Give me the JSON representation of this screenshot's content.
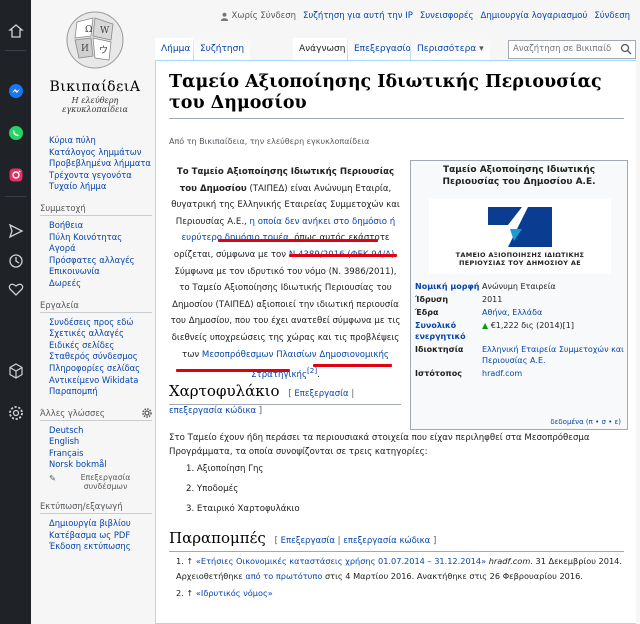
{
  "browser": {
    "rail_icons": [
      "home-icon",
      "messenger-icon",
      "whatsapp-icon",
      "instagram-icon",
      "send-icon",
      "history-icon",
      "heart-icon",
      "cube-icon",
      "settings-icon"
    ]
  },
  "logo": {
    "wordmark": "ΒικιπαίδειΑ",
    "tagline": "Η ελεύθερη εγκυκλοπαίδεια"
  },
  "personal": {
    "anon": "Χωρίς Σύνδεση",
    "talk": "Συζήτηση για αυτή την IP",
    "contribs": "Συνεισφορές",
    "create": "Δημιουργία λογαριασμού",
    "login": "Σύνδεση"
  },
  "tabs": {
    "article": "Λήμμα",
    "talk": "Συζήτηση",
    "read": "Ανάγνωση",
    "edit": "Επεξεργασία",
    "more": "Περισσότερα"
  },
  "search": {
    "placeholder": "Αναζήτηση σε Βικιπαίδ"
  },
  "sidebar": {
    "nav": [
      "Κύρια πύλη",
      "Κατάλογος λημμάτων",
      "Προβεβλημένα λήμματα",
      "Τρέχοντα γεγονότα",
      "Τυχαίο λήμμα"
    ],
    "participation_h": "Συμμετοχή",
    "participation": [
      "Βοήθεια",
      "Πύλη Κοινότητας",
      "Αγορά",
      "Πρόσφατες αλλαγές",
      "Επικοινωνία",
      "Δωρεές"
    ],
    "tools_h": "Εργαλεία",
    "tools": [
      "Συνδέσεις προς εδώ",
      "Σχετικές αλλαγές",
      "Ειδικές σελίδες",
      "Σταθερός σύνδεσμος",
      "Πληροφορίες σελίδας",
      "Αντικείμενο Wikidata",
      "Παραπομπή"
    ],
    "lang_h": "Άλλες γλώσσες",
    "langs": [
      "Deutsch",
      "English",
      "Français",
      "Norsk bokmål"
    ],
    "lang_edit": "Επεξεργασία συνδέσμων",
    "print_h": "Εκτύπωση/εξαγωγή",
    "print": [
      "Δημιουργία βιβλίου",
      "Κατέβασμα ως PDF",
      "Έκδοση εκτύπωσης"
    ]
  },
  "article": {
    "title": "Ταμείο Αξιοποίησης Ιδιωτικής Περιουσίας του Δημοσίου",
    "from": "Από τη Βικιπαίδεια, την ελεύθερη εγκυκλοπαίδεια",
    "lead": {
      "bold": "Το Ταμείο Αξιοποίησης Ιδιωτικής Περιουσίας του Δημοσίου",
      "t1": " (ΤΑΙΠΕΔ) είναι Ανώνυμη Εταιρία, θυγατρική της Ελληνικής Εταιρείας Συμμετοχών και Περιουσίας Α.Ε., ",
      "l1": "η οποία δεν ανήκει στο δημόσιο ή ευρύτερο δημόσιο τομέα",
      "t2": ", όπως αυτός εκάστοτε ορίζεται, σύμφωνα με τον ",
      "l2": "Ν.4389/2016",
      "t3": " ",
      "l3": "(ΦΕΚ 94/Α)",
      "t4": ". Σύμφωνα με τον ιδρυτικό του νόμο (Ν. 3986/2011), το Ταμείο Αξιοποίησης Ιδιωτικής Περιουσίας του Δημοσίου (ΤΑΙΠΕΔ) αξιοποιεί την ιδιωτική περιουσία του Δημοσίου, που του έχει ανατεθεί σύμφωνα με τις διεθνείς υποχρεώσεις της χώρας και τις προβλέψεις των ",
      "l4": "Μεσοπρόθεσμων Πλαισίων Δημοσιονομικής Στρατηγικής",
      "sup": "[2]",
      "t5": "."
    },
    "portfolio_h": "Χαρτοφυλάκιο",
    "edit_label": "Επεξεργασία",
    "edit_code": "επεξεργασία κώδικα",
    "portfolio_p": "Στο Ταμείο έχουν ήδη περάσει τα περιουσιακά στοιχεία που είχαν περιληφθεί στα Μεσοπρόθεσμα Προγράμματα, τα οποία συνοψίζονται σε τρεις κατηγορίες:",
    "portfolio_list": [
      "1.  Αξιοποίηση Γης",
      "2.  Υποδομές",
      "3.  Εταιρικό Χαρτοφυλάκιο"
    ],
    "refs_h": "Παραπομπές",
    "refs": {
      "r1_pre": "1. ↑ ",
      "r1_link": "«Ετήσιες Οικονομικές καταστάσεις χρήσης 01.07.2014 – 31.12.2014»",
      "r1_it": " hradf.com",
      "r1_rest": ". 31 Δεκεμβρίου 2014. Αρχειοθετήθηκε ",
      "r1_link2": "από το πρωτότυπο",
      "r1_end": " στις 4 Μαρτίου 2016. Ανακτήθηκε στις 26 Φεβρουαρίου 2016.",
      "r2_pre": "2. ↑ ",
      "r2_link": "«Ιδρυτικός νόμος»"
    }
  },
  "infobox": {
    "title": "Ταμείο Αξιοποίησης Ιδιωτικής Περιουσίας του Δημοσίου Α.Ε.",
    "logo_text1": "ΤΑΜΕΙΟ ΑΞΙΟΠΟΙΗΣΗΣ ΙΔΙΩΤΙΚΗΣ",
    "logo_text2": "ΠΕΡΙΟΥΣΙΑΣ ΤΟΥ ΔΗΜΟΣΙΟΥ ΑΕ",
    "rows": [
      {
        "k": "Νομική μορφή",
        "v": "Ανώνυμη Εταιρεία"
      },
      {
        "k": "Ίδρυση",
        "v": "2011"
      },
      {
        "k": "Έδρα",
        "v": "Αθήνα, Ελλάδα"
      },
      {
        "k": "Συνολικό ενεργητικό",
        "v": "€1,222 δις (2014)[1]"
      },
      {
        "k": "Ιδιοκτησία",
        "v": "Ελληνική Εταιρεία Συμμετοχών και Περιουσίας Α.Ε."
      },
      {
        "k": "Ιστότοπος",
        "v": "hradf.com"
      }
    ],
    "foot": "δεδομένα (π • σ • ε)"
  },
  "colors": {
    "link": "#0645ad",
    "underline": "#e0000f",
    "logo_blue": "#0a3d91"
  }
}
